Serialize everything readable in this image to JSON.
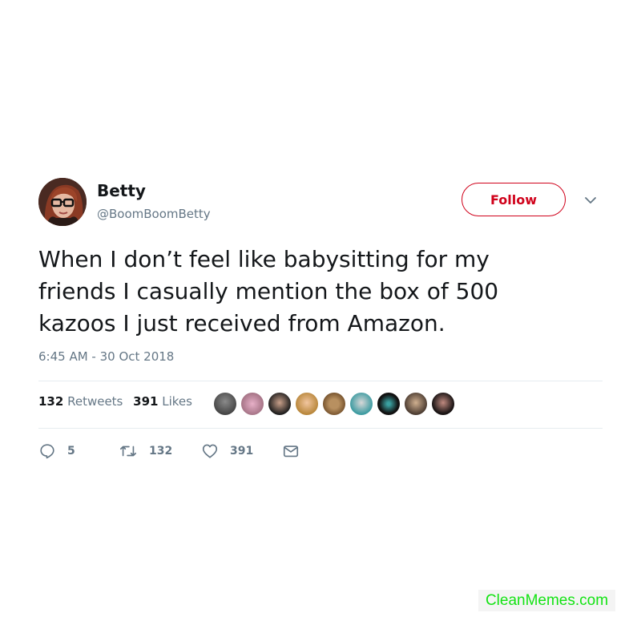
{
  "tweet": {
    "display_name": "Betty",
    "handle": "@BoomBoomBetty",
    "follow_label": "Follow",
    "text": "When I don’t feel like babysitting for my friends I casually mention the box of 500 kazoos I just received from Amazon.",
    "timestamp": "6:45 AM - 30 Oct 2018",
    "stats": {
      "retweets_count": "132",
      "retweets_label": "Retweets",
      "likes_count": "391",
      "likes_label": "Likes"
    },
    "actions": {
      "replies": "5",
      "retweets": "132",
      "likes": "391"
    },
    "icons": {
      "caret": "chevron-down-icon",
      "reply": "reply-icon",
      "retweet": "retweet-icon",
      "like": "heart-icon",
      "message": "envelope-icon"
    }
  },
  "colors": {
    "accent": "#d0021b",
    "text_primary": "#14171a",
    "text_secondary": "#657786",
    "divider": "#e6ecf0",
    "watermark": "#14e314"
  },
  "watermark": "CleanMemes.com"
}
